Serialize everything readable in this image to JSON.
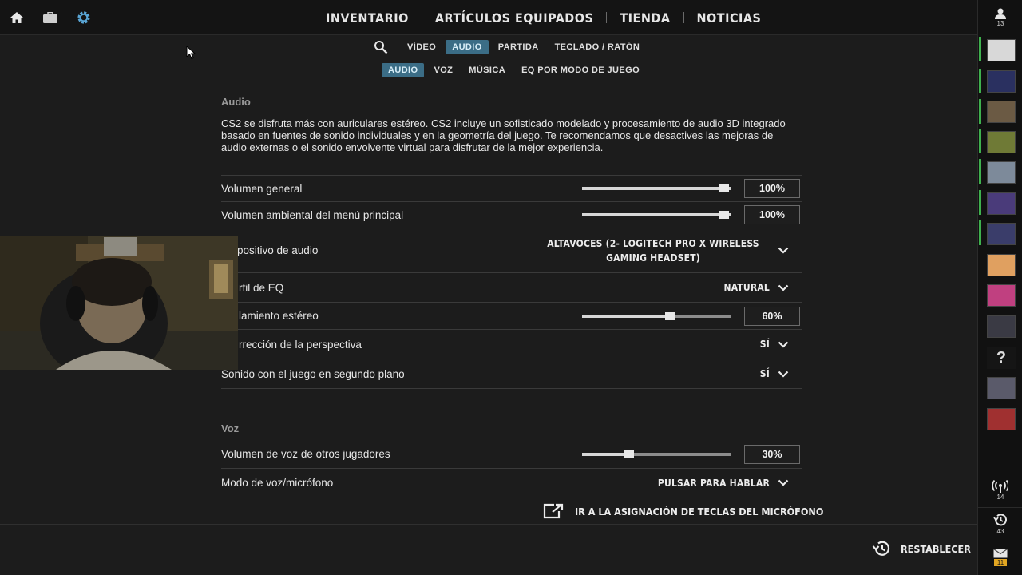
{
  "topbar": {
    "icons": [
      "home-icon",
      "inventory-briefcase-icon",
      "settings-gear-icon"
    ],
    "nav": [
      "INVENTARIO",
      "ARTÍCULOS EQUIPADOS",
      "TIENDA",
      "NOTICIAS"
    ]
  },
  "settings_tabs": {
    "primary": [
      "VÍDEO",
      "AUDIO",
      "PARTIDA",
      "TECLADO / RATÓN"
    ],
    "primary_active": "AUDIO",
    "secondary": [
      "AUDIO",
      "VOZ",
      "MÚSICA",
      "EQ POR MODO DE JUEGO"
    ],
    "secondary_active": "AUDIO"
  },
  "audio": {
    "title": "Audio",
    "description": "CS2 se disfruta más con auriculares estéreo. CS2 incluye un sofisticado modelado y procesamiento de audio 3D integrado basado en fuentes de sonido individuales y en la geometría del juego. Te recomendamos que desactives las mejoras de audio externas o el sonido envolvente virtual para disfrutar de la mejor experiencia.",
    "rows": [
      {
        "label": "Volumen general",
        "type": "slider",
        "value": "100%",
        "level": 1.0
      },
      {
        "label": "Volumen ambiental del menú principal",
        "type": "slider",
        "value": "100%",
        "level": 1.0
      },
      {
        "label": "positivo de audio",
        "type": "dropdown",
        "value": "ALTAVOCES (2- LOGITECH PRO X WIRELESS GAMING HEADSET)"
      },
      {
        "label": "rfil de EQ",
        "type": "dropdown",
        "value": "NATURAL"
      },
      {
        "label": "lamiento estéreo",
        "type": "slider",
        "value": "60%",
        "level": 0.6
      },
      {
        "label": "rrección de la perspectiva",
        "type": "dropdown",
        "value": "SÍ"
      },
      {
        "label": "Sonido con el juego en segundo plano",
        "type": "dropdown",
        "value": "SÍ"
      }
    ]
  },
  "voz": {
    "title": "Voz",
    "rows": [
      {
        "label": "Volumen de voz de otros jugadores",
        "type": "slider",
        "value": "30%",
        "level": 0.3
      },
      {
        "label": "Modo de voz/micrófono",
        "type": "dropdown",
        "value": "PULSAR PARA HABLAR"
      }
    ],
    "mic_link": "IR A LA ASIGNACIÓN DE TECLAS DEL MICRÓFONO"
  },
  "footer": {
    "reset_label": "RESTABLECER"
  },
  "sidebar": {
    "friends_count": "13",
    "help_label": "?",
    "stream_count": "14",
    "history_count": "43",
    "mail_count": "11"
  },
  "colors": {
    "accent_tab": "#3b6d86",
    "online": "#3fb14e",
    "mail_badge": "#e2a622"
  }
}
